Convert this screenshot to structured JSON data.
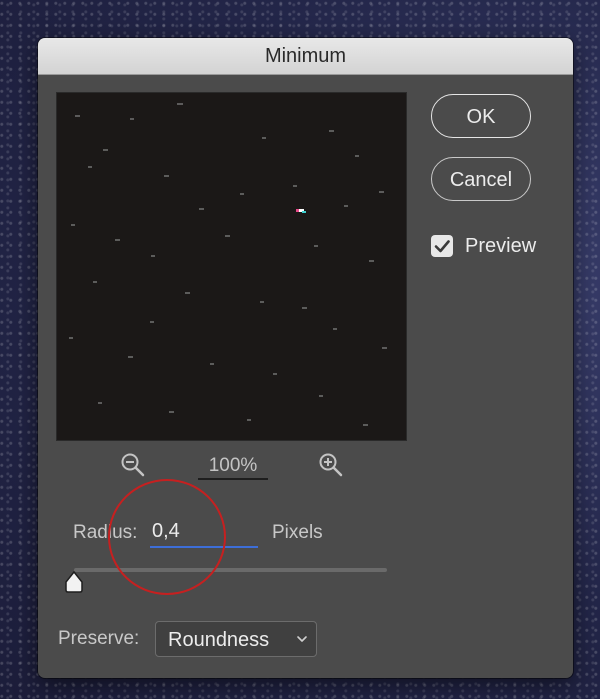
{
  "dialog": {
    "title": "Minimum",
    "ok_label": "OK",
    "cancel_label": "Cancel",
    "preview_checkbox": {
      "label": "Preview",
      "checked": true
    },
    "zoom": {
      "level": "100%",
      "zoom_out_icon": "zoom-out-icon",
      "zoom_in_icon": "zoom-in-icon"
    },
    "radius": {
      "label": "Radius:",
      "value": "0,4",
      "units": "Pixels",
      "slider_fraction": 0.0
    },
    "preserve": {
      "label": "Preserve:",
      "selected": "Roundness"
    }
  },
  "colors": {
    "dialog_bg": "#4b4b4b",
    "titlebar_bg": "#d8d8d8",
    "preview_bg": "#1b1817",
    "accent_underline": "#3d6ed8",
    "annotation_circle": "#c62020"
  }
}
